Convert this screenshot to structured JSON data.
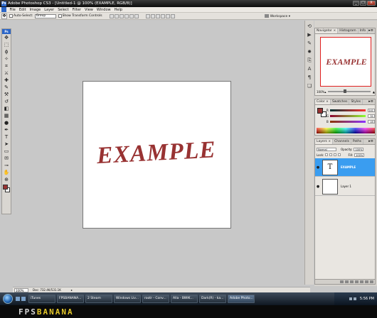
{
  "window": {
    "title": "Adobe Photoshop CS3 - [Untitled-1 @ 100% (EXAMPLE, RGB/8)]",
    "app_icon": "Ps",
    "controls": [
      "_",
      "□",
      "X"
    ]
  },
  "menubar": {
    "items": [
      "File",
      "Edit",
      "Image",
      "Layer",
      "Select",
      "Filter",
      "View",
      "Window",
      "Help"
    ]
  },
  "options": {
    "auto_select_label": "Auto-Select:",
    "auto_select_value": "Group",
    "transform_label": "Show Transform Controls",
    "workspace_label": "Workspace ▾"
  },
  "tools": {
    "badge": "Ps",
    "icons": [
      "move-tool",
      "marquee-tool",
      "lasso-tool",
      "magic-wand-tool",
      "crop-tool",
      "slice-tool",
      "healing-brush-tool",
      "brush-tool",
      "clone-stamp-tool",
      "history-brush-tool",
      "eraser-tool",
      "gradient-tool",
      "dodge-tool",
      "pen-tool",
      "type-tool",
      "path-selection-tool",
      "shape-tool",
      "notes-tool",
      "eyedropper-tool",
      "hand-tool",
      "zoom-tool"
    ],
    "glyphs": [
      "✥",
      "⬚",
      "ϕ",
      "✧",
      "⌗",
      "⚔",
      "✚",
      "✎",
      "⚒",
      "↺",
      "◧",
      "▦",
      "●",
      "✒",
      "T",
      "➤",
      "▭",
      "✉",
      "⊸",
      "✋",
      "⊕"
    ],
    "foreground_color": "#983232",
    "background_color": "#ffffff"
  },
  "document": {
    "artwork_text": "EXAMPLE",
    "artwork_color": "#983232",
    "zoom": "100%",
    "doc_info": "Doc: 732.4K/531.1K"
  },
  "right_strip": {
    "icons": [
      "history-icon",
      "actions-icon",
      "tool-presets-icon",
      "brushes-icon",
      "clone-source-icon",
      "character-icon",
      "paragraph-icon",
      "layer-comps-icon"
    ],
    "glyphs": [
      "⟲",
      "▶",
      "✎",
      "✹",
      "⎘",
      "A",
      "¶",
      "❏"
    ]
  },
  "navigator": {
    "tabs": [
      "Navigator ×",
      "Histogram",
      "Info"
    ],
    "menu_glyph": "▸≡",
    "zoom_value": "100%",
    "thumbnail_text": "EXAMPLE"
  },
  "color_panel": {
    "tabs": [
      "Color ×",
      "Swatches",
      "Styles"
    ],
    "menu_glyph": "▸≡",
    "channels": [
      {
        "label": "R",
        "value": "141",
        "bar": "linear-gradient(to right, #003232, #ff3232)"
      },
      {
        "label": "G",
        "value": "51",
        "bar": "linear-gradient(to right, #8d0032, #8dff32)"
      },
      {
        "label": "B",
        "value": "45",
        "bar": "linear-gradient(to right, #8d3300, #8d33ff)"
      }
    ],
    "foreground_color": "#983232",
    "background_color": "#ffffff"
  },
  "layers_panel": {
    "tabs": [
      "Layers ×",
      "Channels",
      "Paths"
    ],
    "menu_glyph": "▸≡",
    "blend_mode": "Normal",
    "opacity_label": "Opacity:",
    "opacity_value": "100%",
    "lock_label": "Lock:",
    "fill_label": "Fill:",
    "fill_value": "100%",
    "layers": [
      {
        "name": "EXAMPLE",
        "thumb": "T",
        "selected": true
      },
      {
        "name": "Layer 1",
        "thumb": "",
        "selected": false
      }
    ]
  },
  "taskbar": {
    "buttons": [
      "iTunes",
      "FPSBANANA...",
      "2 Steam",
      "Windows Liv...",
      "rootr - Conv...",
      "Alla - BWIK...",
      "Dark(R) - ka...",
      "Adobe Photo..."
    ],
    "active_index": 7,
    "clock": "5:56 PM"
  },
  "brand": {
    "part_a": "FPS",
    "part_b": "BANANA"
  }
}
